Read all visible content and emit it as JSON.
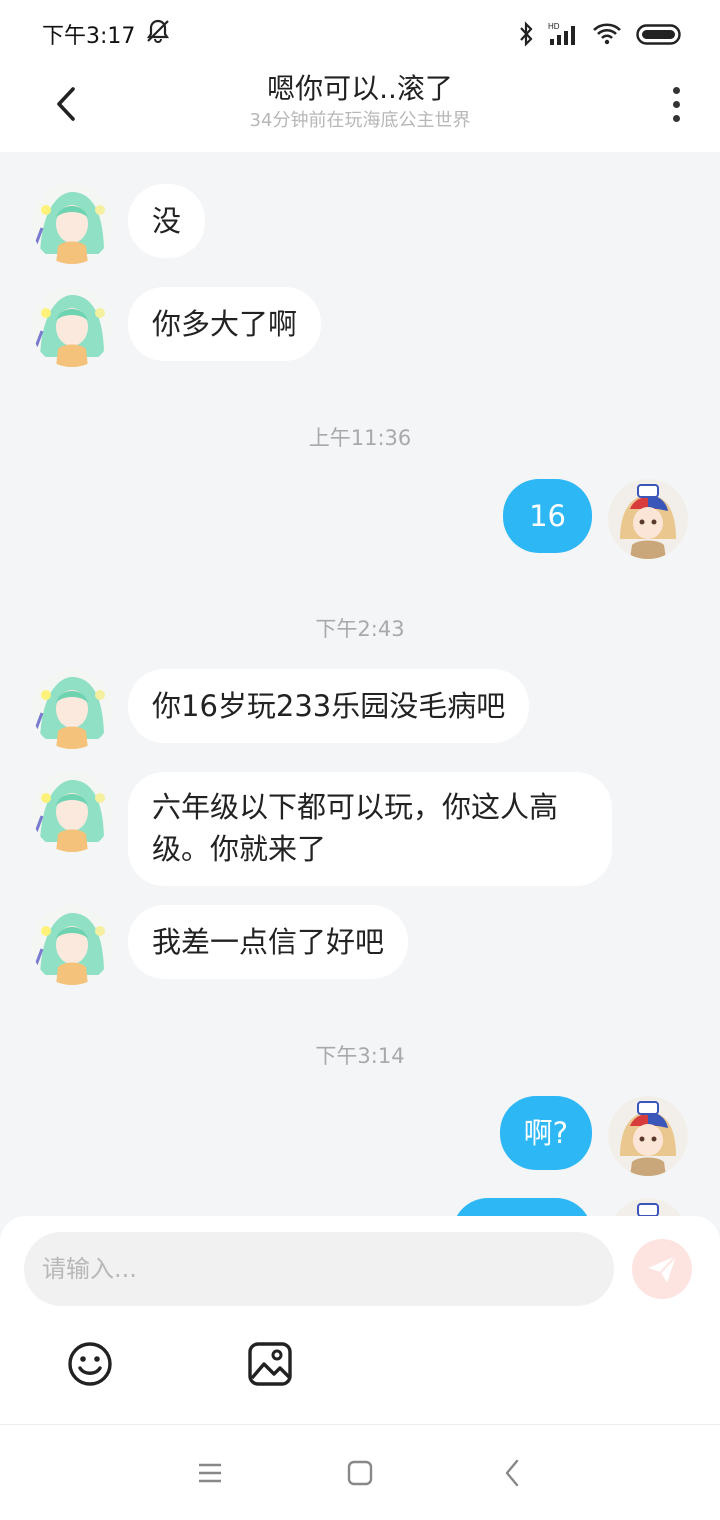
{
  "status_bar": {
    "time": "下午3:17",
    "icons": [
      "notifications-off-icon",
      "bluetooth-icon",
      "signal-icon",
      "wifi-icon",
      "battery-icon"
    ]
  },
  "header": {
    "title": "嗯你可以..滚了",
    "subtitle": "34分钟前在玩海底公主世界",
    "back_icon": "chevron-left-icon",
    "more_icon": "more-vertical-icon"
  },
  "chat": {
    "messages": [
      {
        "direction": "in",
        "text": "没"
      },
      {
        "direction": "in",
        "text": "你多大了啊"
      },
      {
        "type": "time",
        "text": "上午11:36"
      },
      {
        "direction": "out",
        "text": "16"
      },
      {
        "type": "time",
        "text": "下午2:43"
      },
      {
        "direction": "in",
        "text": "你16岁玩233乐园没毛病吧"
      },
      {
        "direction": "in",
        "text": "六年级以下都可以玩，你这人高级。你就来了"
      },
      {
        "direction": "in",
        "text": "我差一点信了好吧"
      },
      {
        "type": "time",
        "text": "下午3:14"
      },
      {
        "direction": "out",
        "text": "啊?"
      },
      {
        "direction": "out",
        "text": ""
      }
    ]
  },
  "composer": {
    "placeholder": "请输入...",
    "send_icon": "send-icon",
    "emoji_icon": "emoji-icon",
    "image_icon": "image-icon"
  },
  "colors": {
    "outgoing_bubble": "#2db7f5",
    "incoming_bubble": "#ffffff",
    "chat_background": "#f4f5f7",
    "send_button": "#fde4e0"
  },
  "nav": {
    "icons": [
      "menu-icon",
      "home-icon",
      "back-icon"
    ]
  }
}
